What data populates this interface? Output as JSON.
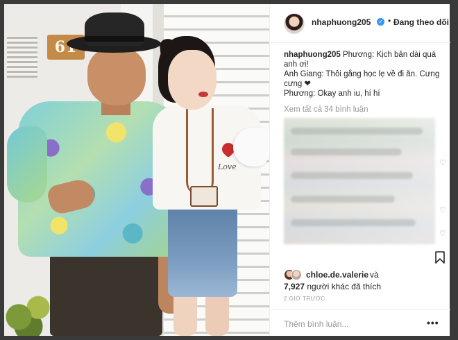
{
  "post": {
    "house_number": "61",
    "shirt_text": "Love"
  },
  "header": {
    "username": "nhaphuong205",
    "verified_icon": "check-icon",
    "separator": "•",
    "follow_state": "Đang theo dõi"
  },
  "caption": {
    "username": "nhaphuong205",
    "line1": "Phương: Kịch bản dài quá anh ơi!",
    "line2": "Anh Giang: Thôi gắng học lẹ về đi ăn. Cưng cưng ❤",
    "line3": "Phương: Okay anh iu, hí hí"
  },
  "comments": {
    "view_all": "Xem tất cả 34 bình luận",
    "heart_icon": "heart-outline-icon",
    "content_state": "blurred"
  },
  "actions": {
    "save_icon": "bookmark-icon"
  },
  "likes": {
    "user": "chloe.de.valerie",
    "and_text": "và",
    "count": "7,927",
    "suffix": "người khác đã thích"
  },
  "timestamp": "2 GIỜ TRƯỚC",
  "comment_box": {
    "placeholder": "Thêm bình luận...",
    "more_icon": "more-dots-icon",
    "more_glyph": "•••"
  },
  "colors": {
    "verified": "#3897f0",
    "text": "#262626",
    "muted": "#999999"
  }
}
